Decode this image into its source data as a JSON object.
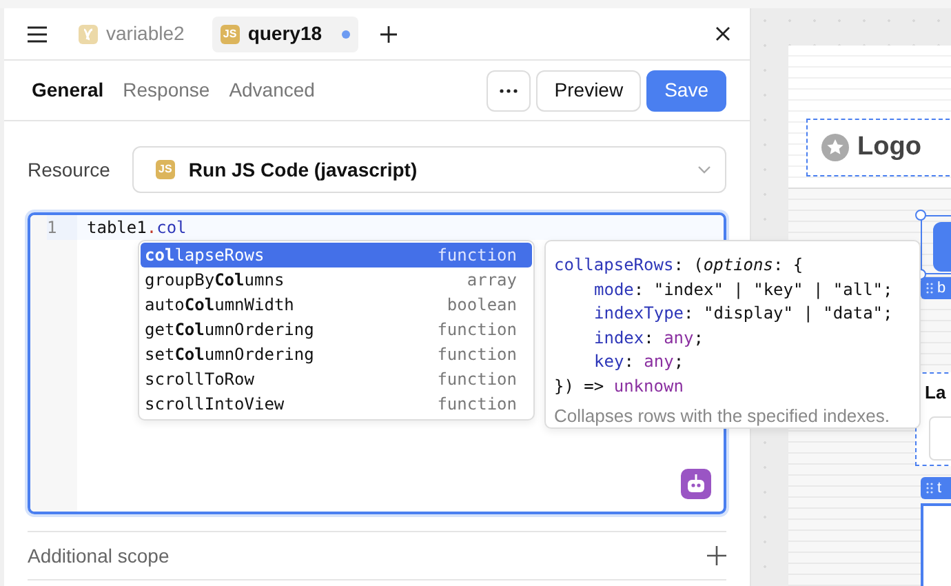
{
  "tabs": [
    {
      "label": "variable2",
      "kind": "variable",
      "selected": false,
      "unsaved": false
    },
    {
      "label": "query18",
      "kind": "js",
      "icon_text": "JS",
      "selected": true,
      "unsaved": true
    }
  ],
  "section_tabs": [
    {
      "label": "General",
      "selected": true
    },
    {
      "label": "Response",
      "selected": false
    },
    {
      "label": "Advanced",
      "selected": false
    }
  ],
  "actions": [
    {
      "kind": "more"
    },
    {
      "kind": "secondary",
      "label": "Preview"
    },
    {
      "kind": "primary",
      "label": "Save"
    }
  ],
  "resource": {
    "label": "Resource",
    "icon_text": "JS",
    "value": "Run JS Code (javascript)"
  },
  "editor": {
    "line_numbers": [
      "1"
    ],
    "code": [
      {
        "text": "table1",
        "kind": "ident"
      },
      {
        "text": ".",
        "kind": "punct"
      },
      {
        "text": "col",
        "kind": "prop"
      }
    ]
  },
  "autocomplete": [
    {
      "label": "**col**lapseRows",
      "type": "function",
      "selected": true
    },
    {
      "label": "groupBy**Col**umns",
      "type": "array",
      "selected": false
    },
    {
      "label": "auto**Col**umnWidth",
      "type": "boolean",
      "selected": false
    },
    {
      "label": "get**Col**umnOrdering",
      "type": "function",
      "selected": false
    },
    {
      "label": "set**Col**umnOrdering",
      "type": "function",
      "selected": false
    },
    {
      "label": "scrollToRow",
      "type": "function",
      "selected": false
    },
    {
      "label": "scrollIntoView",
      "type": "function",
      "selected": false
    }
  ],
  "tooltip": {
    "signature": [
      {
        "indented": false,
        "tokens": [
          {
            "text": "collapseRows",
            "kind": "name"
          },
          {
            "text": ": (",
            "kind": "plain"
          },
          {
            "text": "options",
            "kind": "param"
          },
          {
            "text": ": {",
            "kind": "plain"
          }
        ]
      },
      {
        "indented": true,
        "tokens": [
          {
            "text": "mode",
            "kind": "prop"
          },
          {
            "text": ": \"index\" | \"key\" | \"all\";",
            "kind": "plain"
          }
        ]
      },
      {
        "indented": true,
        "tokens": [
          {
            "text": "indexType",
            "kind": "prop"
          },
          {
            "text": ": \"display\" | \"data\";",
            "kind": "plain"
          }
        ]
      },
      {
        "indented": true,
        "tokens": [
          {
            "text": "index",
            "kind": "prop"
          },
          {
            "text": ": ",
            "kind": "plain"
          },
          {
            "text": "any",
            "kind": "type"
          },
          {
            "text": ";",
            "kind": "plain"
          }
        ]
      },
      {
        "indented": true,
        "tokens": [
          {
            "text": "key",
            "kind": "prop"
          },
          {
            "text": ": ",
            "kind": "plain"
          },
          {
            "text": "any",
            "kind": "type"
          },
          {
            "text": ";",
            "kind": "plain"
          }
        ]
      },
      {
        "indented": false,
        "tokens": [
          {
            "text": "}) => ",
            "kind": "plain"
          },
          {
            "text": "unknown",
            "kind": "type"
          }
        ]
      }
    ],
    "description": "Collapses rows with the specified indexes."
  },
  "additional_scope": {
    "label": "Additional scope"
  },
  "canvas": {
    "logo": "Logo",
    "component_tags": [
      "b",
      "t"
    ],
    "field_label": "La"
  }
}
